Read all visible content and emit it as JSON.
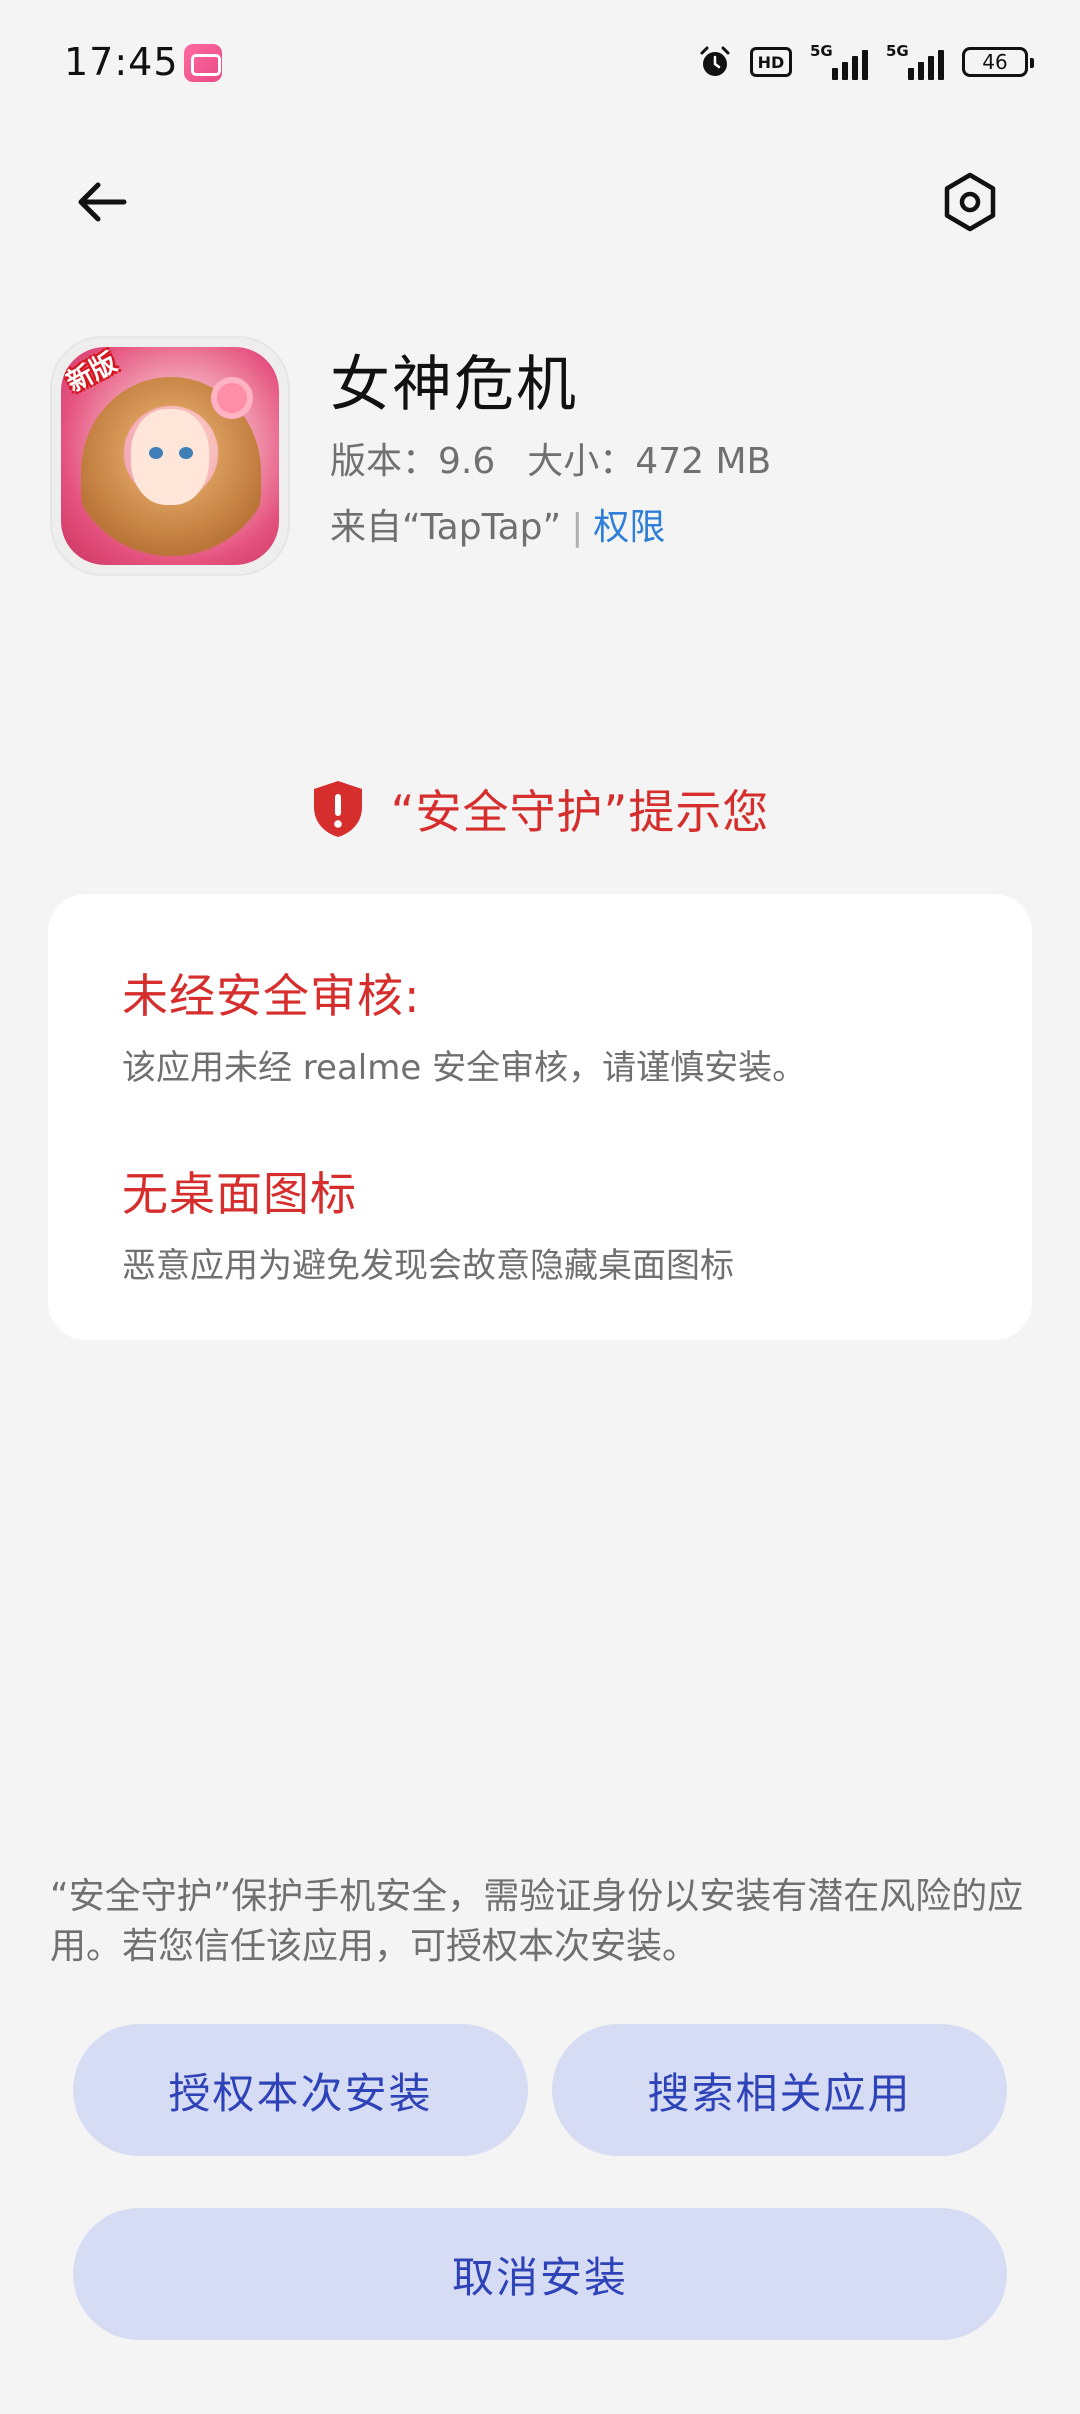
{
  "status_bar": {
    "time": "17:45",
    "app_icon": "bilibili-icon",
    "hd_label": "HD",
    "signal_1": "5G",
    "signal_2": "5G",
    "battery": "46"
  },
  "nav": {
    "back_icon": "back-arrow-icon",
    "settings_icon": "settings-hexagon-icon"
  },
  "app": {
    "name": "女神危机",
    "icon_badge": "新版",
    "version_label": "版本：",
    "version": "9.6",
    "size_label": "大小：",
    "size": "472 MB",
    "source": "来自“TapTap”",
    "separator": "|",
    "permissions_link": "权限"
  },
  "warning": {
    "icon": "shield-alert-icon",
    "title": "“安全守护”提示您",
    "color": "#d62d2d"
  },
  "risks": [
    {
      "title": "未经安全审核:",
      "desc": "该应用未经 realme 安全审核，请谨慎安装。"
    },
    {
      "title": "无桌面图标",
      "desc": "恶意应用为避免发现会故意隐藏桌面图标"
    }
  ],
  "notice": "“安全守护”保护手机安全，需验证身份以安装有潜在风险的应用。若您信任该应用，可授权本次安装。",
  "buttons": {
    "authorize": "授权本次安装",
    "search": "搜索相关应用",
    "cancel": "取消安装",
    "bg_color": "#d7dcf5",
    "text_color": "#2f43b8"
  }
}
